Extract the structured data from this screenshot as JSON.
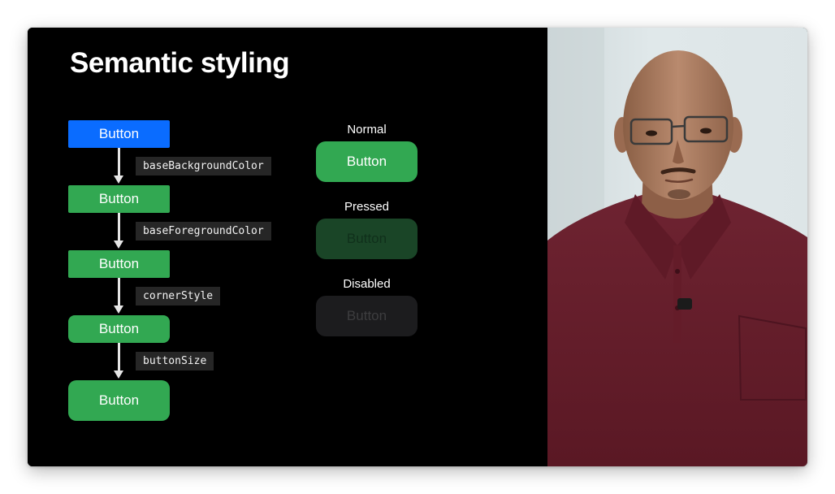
{
  "slide": {
    "title": "Semantic styling",
    "chain": {
      "buttons": [
        "Button",
        "Button",
        "Button",
        "Button",
        "Button"
      ],
      "properties": [
        "baseBackgroundColor",
        "baseForegroundColor",
        "cornerStyle",
        "buttonSize"
      ]
    },
    "states": [
      {
        "label": "Normal",
        "button": "Button"
      },
      {
        "label": "Pressed",
        "button": "Button"
      },
      {
        "label": "Disabled",
        "button": "Button"
      }
    ]
  },
  "colors": {
    "blue": "#0a6cff",
    "green": "#32a852",
    "pressed": "#1a4527",
    "disabled": "#1c1c1e",
    "shirt": "#6b1f2c"
  }
}
